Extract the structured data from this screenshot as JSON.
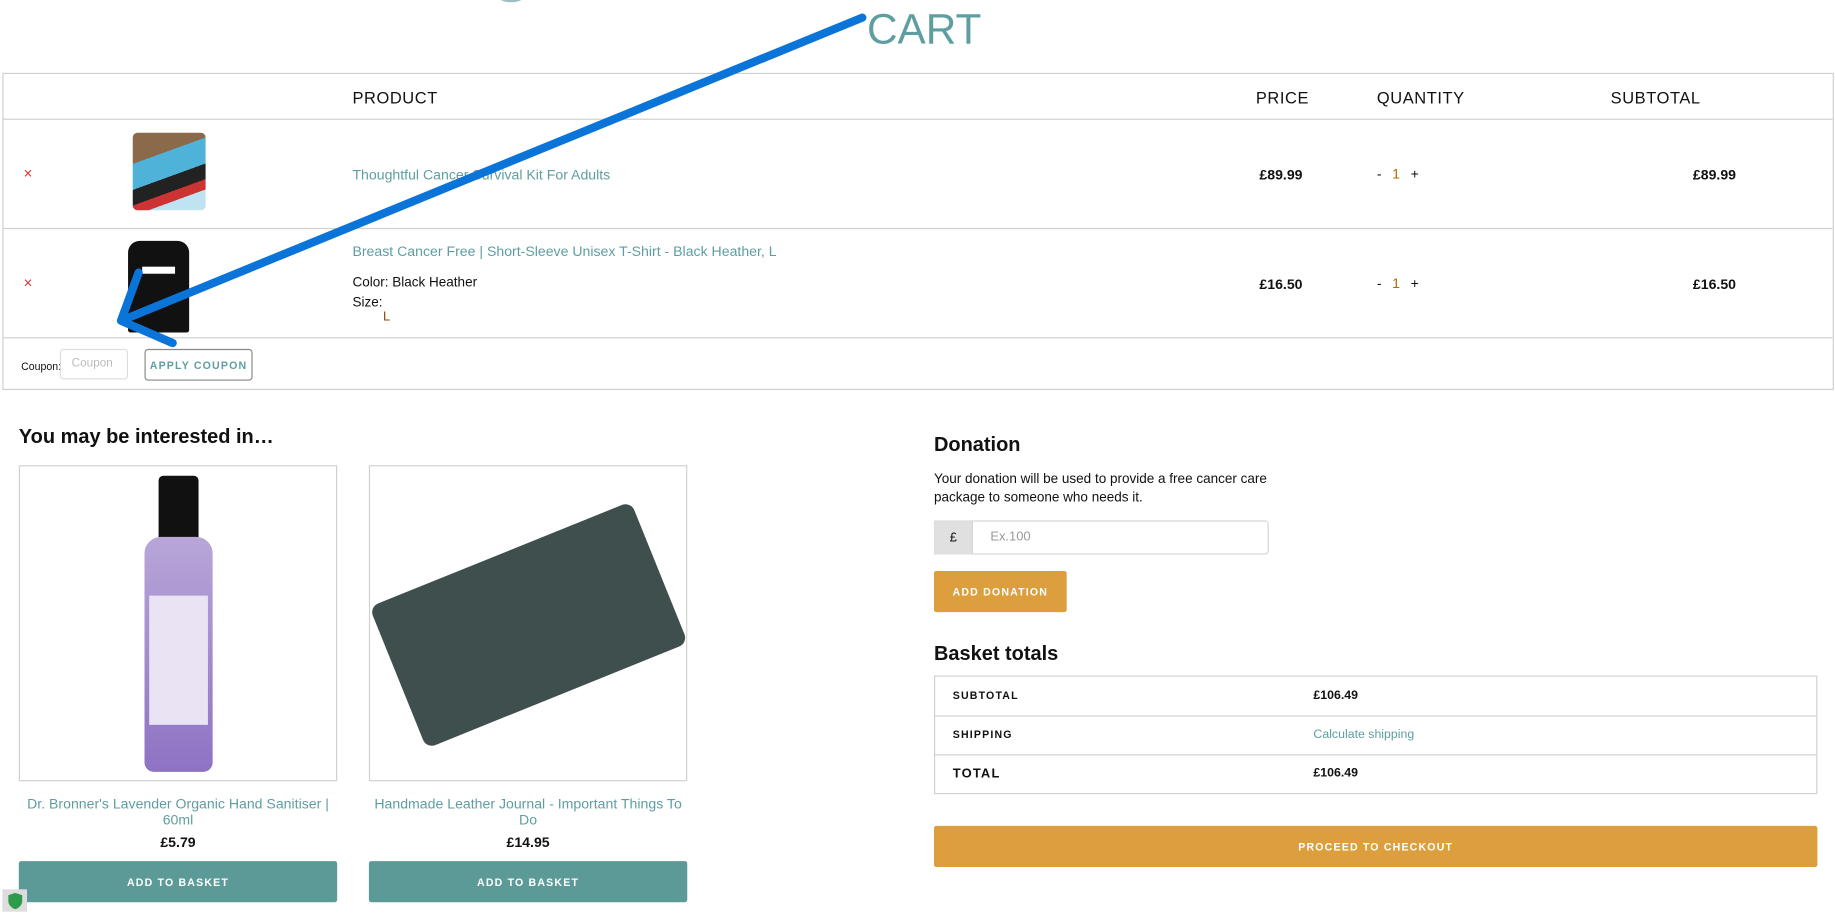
{
  "page": {
    "title": "CART"
  },
  "table": {
    "headers": [
      "PRODUCT",
      "PRICE",
      "QUANTITY",
      "SUBTOTAL"
    ],
    "rows": [
      {
        "name": "Thoughtful Cancer Survival Kit For Adults",
        "price": "£89.99",
        "qty": "1",
        "subtotal": "£89.99",
        "remove": "×"
      },
      {
        "name": "Breast Cancer Free | Short-Sleeve Unisex T-Shirt - Black Heather, L",
        "color_label": "Color: Black Heather",
        "size_label": "Size:",
        "size_value": "L",
        "price": "£16.50",
        "qty": "1",
        "subtotal": "£16.50",
        "remove": "×"
      }
    ],
    "minus": "-",
    "plus": "+"
  },
  "coupon": {
    "label": "Coupon:",
    "placeholder": "Coupon",
    "button": "APPLY COUPON"
  },
  "related": {
    "heading": "You may be interested in…",
    "items": [
      {
        "title": "Dr. Bronner's Lavender Organic Hand Sanitiser | 60ml",
        "price": "£5.79",
        "button": "ADD TO BASKET"
      },
      {
        "title": "Handmade Leather Journal - Important Things To Do",
        "price": "£14.95",
        "button": "ADD TO BASKET"
      }
    ]
  },
  "donation": {
    "heading": "Donation",
    "text": "Your donation will be used to provide a free cancer care package to someone who needs it.",
    "currency": "£",
    "placeholder": "Ex.100",
    "button": "ADD DONATION"
  },
  "totals": {
    "heading": "Basket totals",
    "subtotal_label": "SUBTOTAL",
    "subtotal": "£106.49",
    "shipping_label": "SHIPPING",
    "shipping": "Calculate shipping",
    "total_label": "TOTAL",
    "total": "£106.49",
    "checkout": "PROCEED TO CHECKOUT"
  },
  "colors": {
    "accent": "#5f9ea0",
    "button_orange": "#dd9f3d",
    "remove_red": "#e53030",
    "annotation_arrow": "#0a74d8"
  }
}
